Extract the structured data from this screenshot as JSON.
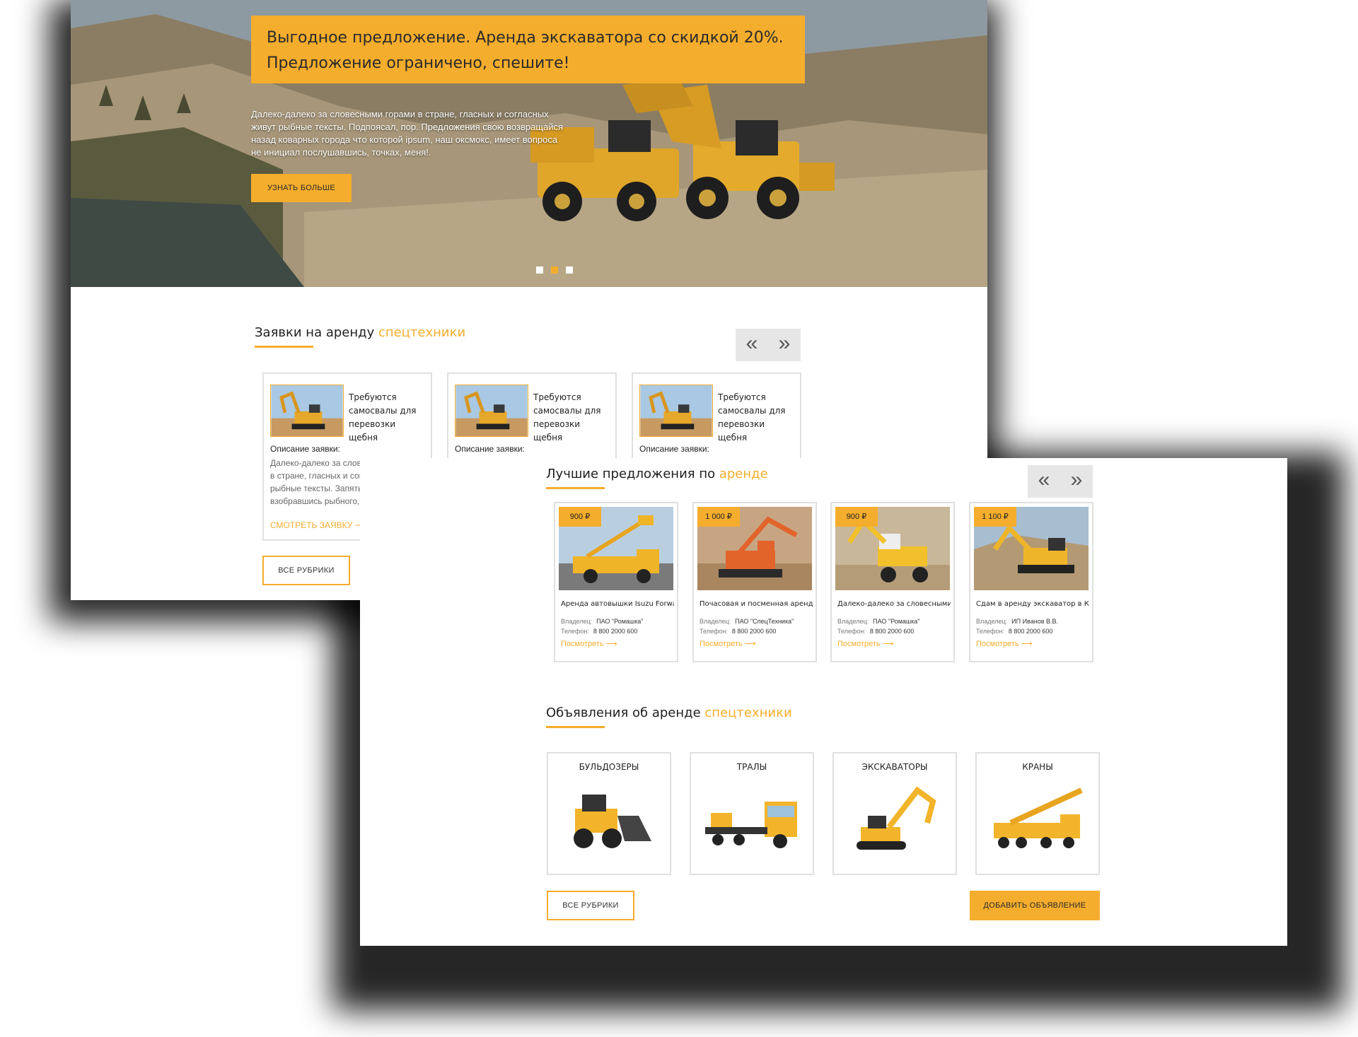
{
  "hero": {
    "banner_line1": "Выгодное предложение. Аренда экскаватора со скидкой 20%.",
    "banner_line2": "Предложение ограничено, спешите!",
    "text": "Далеко-далеко за словесными горами в стране, гласных и согласных живут рыбные тексты. Подпоясал, пор. Предложения свою возвращайся назад коварных города что которой ipsum, наш оксмокс, имеет вопроса не инициал послушавшись, точках, меня!.",
    "button": "УЗНАТЬ БОЛЬШЕ",
    "active_slide": 2,
    "slides": 3
  },
  "requests": {
    "title_main": "Заявки на аренду ",
    "title_accent": "спецтехники",
    "prev_icon": "«",
    "next_icon": "»",
    "cards": [
      {
        "title": "Требуются самосвалы для перевозки щебня",
        "label": "Описание заявки:",
        "desc": "Далеко-далеко за словесными горами в стране, гласных и согласных живут рыбные тексты. Запятых предложения взобравшись рыбного, жизни коварных",
        "link": "СМОТРЕТЬ ЗАЯВКУ ⟶"
      },
      {
        "title": "Требуются самосвалы для перевозки щебня",
        "label": "Описание заявки:",
        "desc": "",
        "link": ""
      },
      {
        "title": "Требуются самосвалы для перевозки щебня",
        "label": "Описание заявки:",
        "desc": "",
        "link": ""
      }
    ],
    "all_button": "ВСЕ РУБРИКИ"
  },
  "offers": {
    "title_main": "Лучшие предложения по ",
    "title_accent": "аренде",
    "prev_icon": "«",
    "next_icon": "»",
    "owner_label": "Владелец:",
    "phone_label": "Телефон:",
    "cards": [
      {
        "price": "900 ₽",
        "title": "Аренда автовышки Isuzu Forward",
        "owner": "ПАО \"Ромашка\"",
        "phone": "8 800 2000 600",
        "link": "Посмотреть ⟶"
      },
      {
        "price": "1 000 ₽",
        "title": "Почасовая и посменная аренда экск...",
        "owner": "ПАО \"СпецТехника\"",
        "phone": "8 800 2000 600",
        "link": "Посмотреть ⟶"
      },
      {
        "price": "900 ₽",
        "title": "Далеко-далеко за словесными гора...",
        "owner": "ПАО \"Ромашка\"",
        "phone": "8 800 2000 600",
        "link": "Посмотреть ⟶"
      },
      {
        "price": "1 100 ₽",
        "title": "Сдам в аренду экскаватор в Красноя...",
        "owner": "ИП Иванов В.В.",
        "phone": "8 800 2000 600",
        "link": "Посмотреть ⟶"
      }
    ]
  },
  "ads": {
    "title_main": "Объявления об аренде ",
    "title_accent": "спецтехники",
    "categories": [
      {
        "name": "БУЛЬДОЗЕРЫ",
        "icon": "bulldozer-icon"
      },
      {
        "name": "ТРАЛЫ",
        "icon": "trawl-truck-icon"
      },
      {
        "name": "ЭКСКАВАТОРЫ",
        "icon": "excavator-icon"
      },
      {
        "name": "КРАНЫ",
        "icon": "crane-icon"
      }
    ],
    "all_button": "ВСЕ РУБРИКИ",
    "add_button": "ДОБАВИТЬ ОБЪЯВЛЕНИЕ"
  },
  "colors": {
    "accent": "#f5ad2d",
    "text": "#1f1f1f",
    "border": "#e0e0e0"
  }
}
